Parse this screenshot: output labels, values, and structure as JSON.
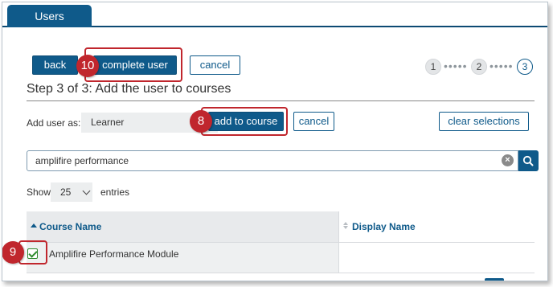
{
  "tab": {
    "label": "Users"
  },
  "toolbar": {
    "back_label": "back",
    "complete_label": "complete user",
    "cancel_label": "cancel"
  },
  "steps": {
    "step1": "1",
    "step2": "2",
    "step3": "3",
    "current": 3
  },
  "heading": "Step 3 of 3: Add the user to courses",
  "add_user": {
    "label": "Add user as:",
    "role_value": "Learner",
    "add_label": "add to course",
    "cancel_label": "cancel",
    "clear_label": "clear selections"
  },
  "search": {
    "value": "amplifire performance"
  },
  "entries": {
    "show_label": "Show",
    "value": "25",
    "suffix": "entries"
  },
  "table": {
    "columns": [
      "Course Name",
      "Display Name"
    ],
    "rows": [
      {
        "course_name": "Amplifire Performance Module",
        "display_name": "",
        "checked": true
      }
    ]
  },
  "callouts": {
    "a": "10",
    "b": "8",
    "c": "9"
  },
  "icons": {
    "clear": "clear-icon",
    "search": "search-icon",
    "checkbox": "checkbox-checked-icon",
    "sort": "sort-icon"
  },
  "colors": {
    "primary": "#0f5a8a",
    "callout": "#c0262d",
    "check": "#2e8b2e"
  }
}
